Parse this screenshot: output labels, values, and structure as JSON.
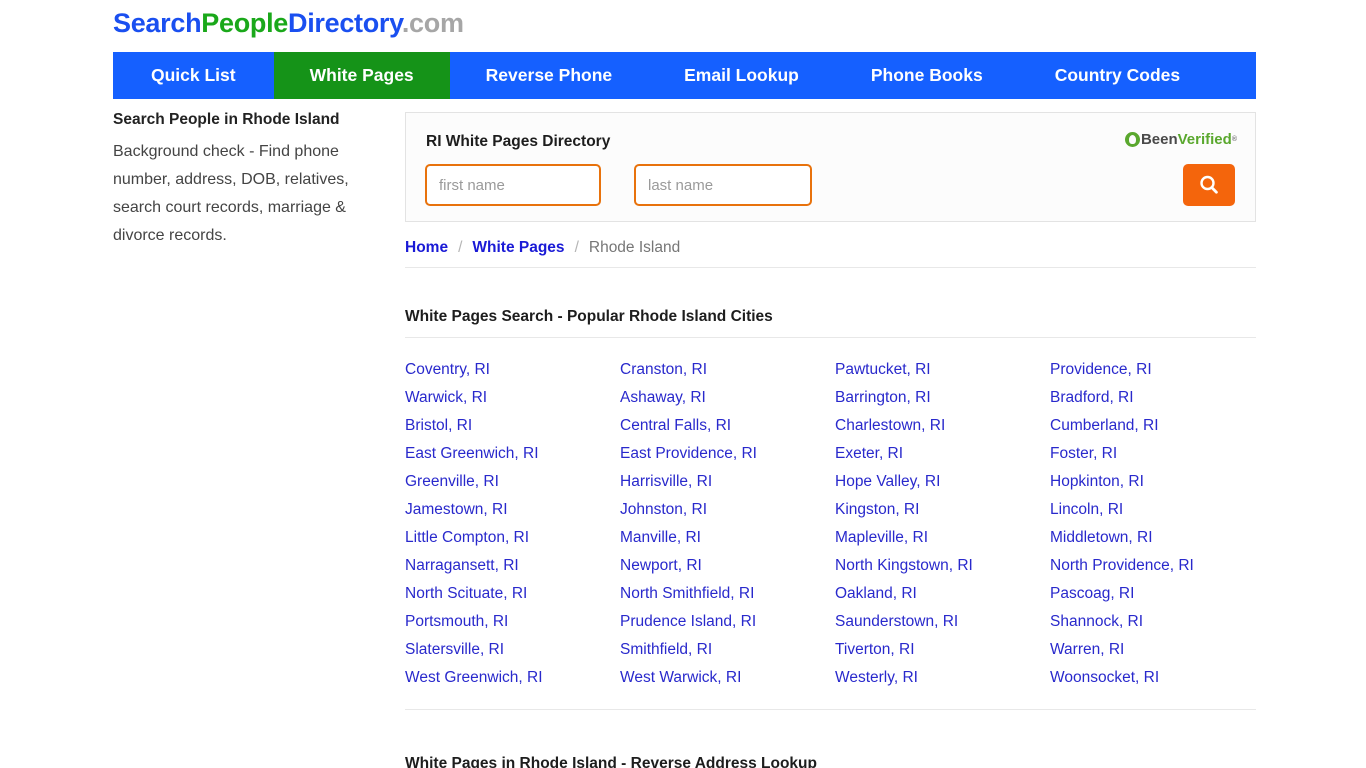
{
  "logo": {
    "search": "Search",
    "people": "People",
    "directory": "Directory",
    "com": ".com"
  },
  "nav": {
    "items": [
      {
        "label": "Quick List",
        "active": false
      },
      {
        "label": "White Pages",
        "active": true
      },
      {
        "label": "Reverse Phone",
        "active": false
      },
      {
        "label": "Email Lookup",
        "active": false
      },
      {
        "label": "Phone Books",
        "active": false
      },
      {
        "label": "Country Codes",
        "active": false
      }
    ],
    "colors": {
      "background": "#1560ff",
      "active_background": "#159318",
      "text": "#ffffff"
    }
  },
  "sidebar": {
    "title": "Search People in Rhode Island",
    "description": "Background check - Find phone number, address, DOB, relatives, search court records, marriage & divorce records."
  },
  "search_panel": {
    "title": "RI White Pages Directory",
    "partner_logo": {
      "been": "Been",
      "verified": "Verified",
      "tm": "®"
    },
    "first_name_placeholder": "first name",
    "first_name_value": "",
    "last_name_placeholder": "last name",
    "last_name_value": "",
    "search_icon": "search-icon",
    "accent_color": "#f4650c",
    "input_border_color": "#e8720c"
  },
  "breadcrumb": {
    "home": "Home",
    "sep1": "/",
    "white_pages": "White Pages",
    "sep2": "/",
    "current": "Rhode Island"
  },
  "headings": {
    "cities": "White Pages Search - Popular Rhode Island Cities",
    "reverse_address": "White Pages in Rhode Island - Reverse Address Lookup"
  },
  "cities": {
    "link_color": "#2929cc",
    "columns": [
      [
        "Coventry,  RI",
        "Warwick,  RI",
        "Bristol,  RI",
        "East Greenwich,  RI",
        "Greenville,  RI",
        "Jamestown,  RI",
        "Little Compton,  RI",
        "Narragansett,  RI",
        "North Scituate,  RI",
        "Portsmouth,  RI",
        "Slatersville,  RI",
        "West Greenwich,  RI"
      ],
      [
        "Cranston,  RI",
        "Ashaway,  RI",
        "Central Falls,  RI",
        "East Providence,  RI",
        "Harrisville,  RI",
        "Johnston,  RI",
        "Manville,  RI",
        "Newport,  RI",
        "North Smithfield,  RI",
        "Prudence Island,  RI",
        "Smithfield,  RI",
        "West Warwick,  RI"
      ],
      [
        "Pawtucket,  RI",
        "Barrington,  RI",
        "Charlestown,  RI",
        "Exeter,  RI",
        "Hope Valley,  RI",
        "Kingston,  RI",
        "Mapleville,  RI",
        "North Kingstown,  RI",
        "Oakland,  RI",
        "Saunderstown,  RI",
        "Tiverton,  RI",
        "Westerly,  RI"
      ],
      [
        "Providence,  RI",
        "Bradford,  RI",
        "Cumberland,  RI",
        "Foster,  RI",
        "Hopkinton,  RI",
        "Lincoln,  RI",
        "Middletown,  RI",
        "North Providence,  RI",
        "Pascoag,  RI",
        "Shannock,  RI",
        "Warren,  RI",
        "Woonsocket,  RI"
      ]
    ]
  }
}
